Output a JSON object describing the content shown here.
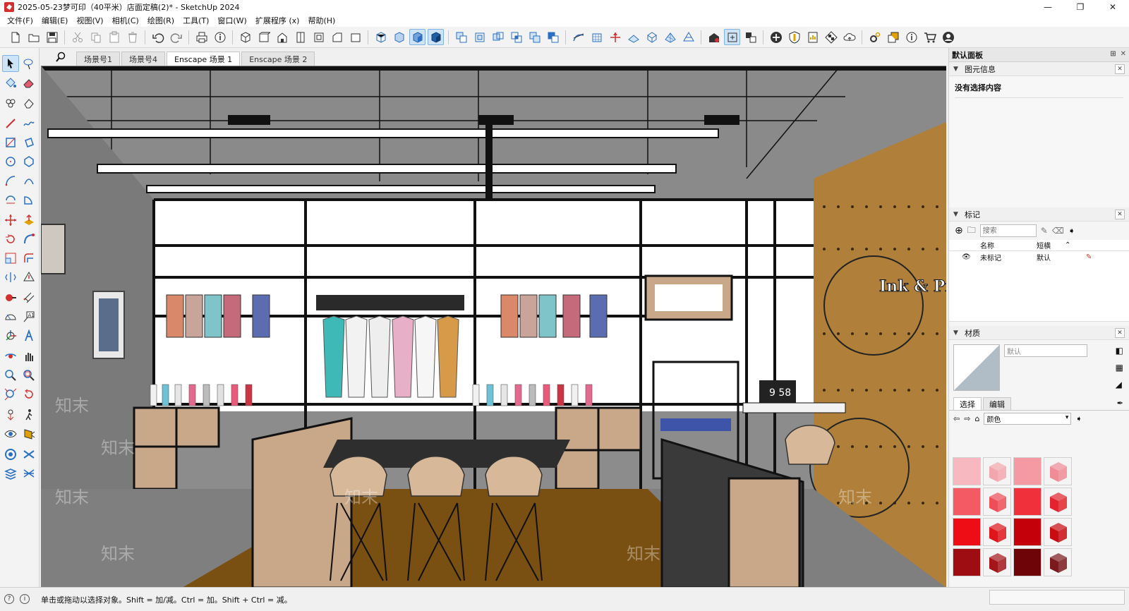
{
  "window": {
    "title": "2025-05-23梦可印（40平米）店面定稿(2)* - SketchUp 2024",
    "min_glyph": "—",
    "max_glyph": "❐",
    "close_glyph": "✕"
  },
  "menu": [
    "文件(F)",
    "编辑(E)",
    "视图(V)",
    "相机(C)",
    "绘图(R)",
    "工具(T)",
    "窗口(W)",
    "扩展程序 (x)",
    "帮助(H)"
  ],
  "scene_tabs": [
    {
      "label": "场景号1",
      "active": false
    },
    {
      "label": "场景号4",
      "active": false
    },
    {
      "label": "Enscape 场景 1",
      "active": true
    },
    {
      "label": "Enscape 场景 2",
      "active": false
    }
  ],
  "viewport": {
    "shop_sign": "Ink & Print",
    "display_clock": "9 58",
    "watermark": "知末"
  },
  "tray": {
    "title": "默认面板",
    "entity_info": {
      "title": "图元信息",
      "empty_text": "没有选择内容"
    },
    "tags": {
      "title": "标记",
      "search_placeholder": "搜索",
      "col_name": "名称",
      "col_dash": "短横",
      "rows": [
        {
          "name": "未标记",
          "dash": "默认"
        }
      ]
    },
    "materials": {
      "title": "材质",
      "name_placeholder": "默认",
      "tab_select": "选择",
      "tab_edit": "编辑",
      "library": "颜色",
      "swatches": [
        {
          "color": "#f8b8bf",
          "cube": false
        },
        {
          "color": "#f4a6ae",
          "cube": true
        },
        {
          "color": "#f59aa2",
          "cube": false
        },
        {
          "color": "#f08c96",
          "cube": true
        },
        {
          "color": "#f45a64",
          "cube": false
        },
        {
          "color": "#ef4d58",
          "cube": true
        },
        {
          "color": "#f0303a",
          "cube": false
        },
        {
          "color": "#e3232d",
          "cube": true
        },
        {
          "color": "#ee0d14",
          "cube": false
        },
        {
          "color": "#e0141b",
          "cube": true
        },
        {
          "color": "#c4000a",
          "cube": false
        },
        {
          "color": "#c90b12",
          "cube": true
        },
        {
          "color": "#9e0d12",
          "cube": false
        },
        {
          "color": "#a5161b",
          "cube": true
        },
        {
          "color": "#6e0408",
          "cube": false
        },
        {
          "color": "#7b1a1e",
          "cube": true
        }
      ]
    }
  },
  "status": {
    "text": "单击或拖动以选择对象。Shift = 加/减。Ctrl = 加。Shift + Ctrl = 减。"
  }
}
